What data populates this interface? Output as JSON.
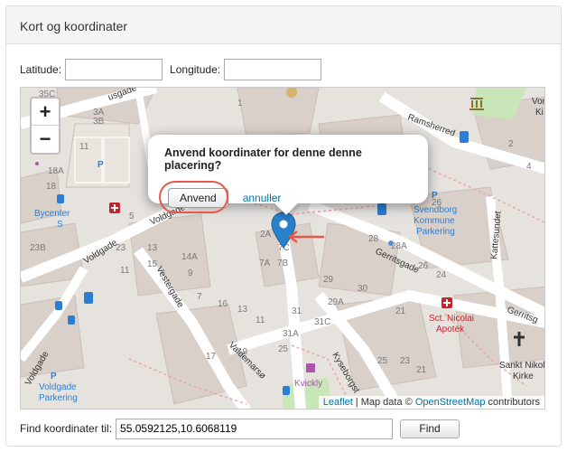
{
  "panel": {
    "title": "Kort og koordinater"
  },
  "coords": {
    "lat_label": "Latitude:",
    "lat_value": "",
    "lng_label": "Longitude:",
    "lng_value": ""
  },
  "map": {
    "zoom_in": "+",
    "zoom_out": "−",
    "popup": {
      "title": "Anvend koordinater for denne denne placering?",
      "apply_label": "Anvend",
      "cancel_label": "annuller"
    },
    "attribution": {
      "leaflet": "Leaflet",
      "sep": " | Map data © ",
      "osm": "OpenStreetMap",
      "tail": " contributors"
    },
    "streets": {
      "s1": "usgade",
      "s2": "Voldgade",
      "s3": "Voldgade",
      "s4": "Vestergade",
      "s5": "Voldgade",
      "s6": "Ramsherred",
      "s7": "Gerritsgade",
      "s8": "Gerritsg",
      "s9": "Kattesundet",
      "s10": "Kyseborgst",
      "s11": "Valdemarsø"
    },
    "pois": {
      "p1": "Bycenter",
      "p2": "S",
      "p3": "Svendborg",
      "p4": "Kommune",
      "p5": "Parkering",
      "p6": "Voldgade",
      "p7": "Parkering",
      "p8": "Sct. Nicolai",
      "p9": "Apotek",
      "p10": "Sankt Nikol",
      "p11": "Kirke",
      "p12": "Kvickly",
      "p13": "Vor",
      "p14": "Ki"
    },
    "numbers": {
      "n1": "35C",
      "n2": "3A",
      "n3": "3B",
      "n4": "11",
      "n5": "18A",
      "n6": "18",
      "n7": "5",
      "n8": "23B",
      "n9": "23",
      "n10": "13",
      "n11": "11",
      "n12": "15",
      "n13": "14A",
      "n14": "9",
      "n15": "7",
      "n16": "16",
      "n17": "13",
      "n18": "11",
      "n19": "7A",
      "n20": "7B",
      "n21": "7C",
      "n22": "28A",
      "n23": "28",
      "n24": "26",
      "n25": "29A",
      "n26": "29",
      "n27": "31",
      "n28": "31C",
      "n29": "30",
      "n30": "31A",
      "n31": "25",
      "n32": "17",
      "n33": "19",
      "n34": "25",
      "n35": "23",
      "n36": "21",
      "n37": "2A",
      "n38": "1",
      "n39": "26",
      "n40": "24",
      "n41": "21",
      "n42": "2",
      "n43": "4"
    }
  },
  "find": {
    "label": "Find koordinater til:",
    "value": "55.0592125,10.6068119",
    "button": "Find"
  },
  "colors": {
    "marker": "#2a81cb",
    "highlight": "#e8564a",
    "link": "#0078a8",
    "road": "#ffffff",
    "building": "#d9d0c9",
    "parking": "#2a7fd4",
    "pharmacy": "#c0272d",
    "shop": "#aa55aa"
  }
}
